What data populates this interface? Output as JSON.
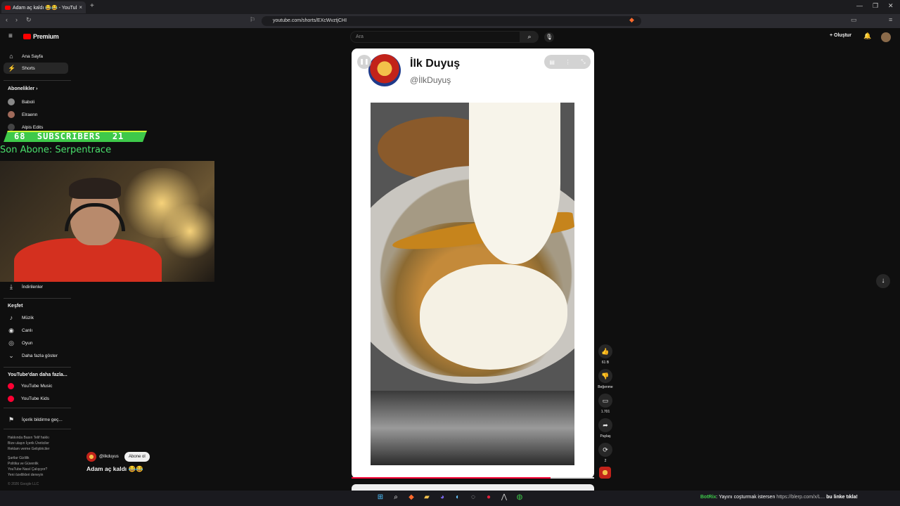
{
  "browser": {
    "tab_title": "Adam aç kaldı 😂😂 - YouTube",
    "url": "youtube.com/shorts/EXcWvztjCHI",
    "new_tab_glyph": "+",
    "close_glyph": "×"
  },
  "header": {
    "logo_text": "Premium",
    "search_placeholder": "Ara",
    "create_label": "+ Oluştur"
  },
  "sidebar": {
    "home": "Ana Sayfa",
    "shorts": "Shorts",
    "subscriptions_heading": "Abonelikler",
    "subscriptions": [
      "Baboli",
      "Elraenn",
      "Alpis Edits"
    ],
    "downloads": "İndirilenler",
    "explore_heading": "Keşfet",
    "explore": [
      "Müzik",
      "Canlı",
      "Oyun",
      "Daha fazla göster"
    ],
    "more_heading": "YouTube'dan daha fazla...",
    "more": [
      "YouTube Music",
      "YouTube Kids"
    ],
    "report": "İçerik bildirme geç...",
    "footer_lines": [
      "Hakkında  Basın  Telif hakkı",
      "Bize ulaşın  İçerik Üreticiler",
      "Reklam verme  Geliştiriciler",
      "",
      "Şartlar  Gizlilik",
      "Politika ve Güvenlik",
      "YouTube Nasıl Çalışıyor?",
      "Yeni özellikleri deneyin",
      "",
      "© 2026 Google LLC"
    ]
  },
  "overlay": {
    "subscribers_text": "68  SUBSCRIBERS  21",
    "last_subscriber": "Son Abone: Serpentrace"
  },
  "player": {
    "channel_name": "İlk Duyuş",
    "channel_handle": "@İlkDuyuş",
    "progress": 0.82
  },
  "actions": [
    {
      "icon": "like-icon",
      "label": "61 B"
    },
    {
      "icon": "dislike-icon",
      "label": "Beğenme"
    },
    {
      "icon": "comment-icon",
      "label": "1.701"
    },
    {
      "icon": "share-icon",
      "label": "Paylaş"
    },
    {
      "icon": "remix-icon",
      "label": "2"
    }
  ],
  "video_meta": {
    "handle": "@ilkduyus",
    "subscribe_label": "Abone ol",
    "title": "Adam aç kaldı 😂😂"
  },
  "chat": {
    "name": "BotRix",
    "message": ": Yayını coşturmak istersen ",
    "url": "https://blerp.com/x/L...",
    "link_text": " bu linke tıkla!"
  },
  "colors": {
    "accent_red": "#ff0033",
    "overlay_green": "#3ec94a"
  }
}
